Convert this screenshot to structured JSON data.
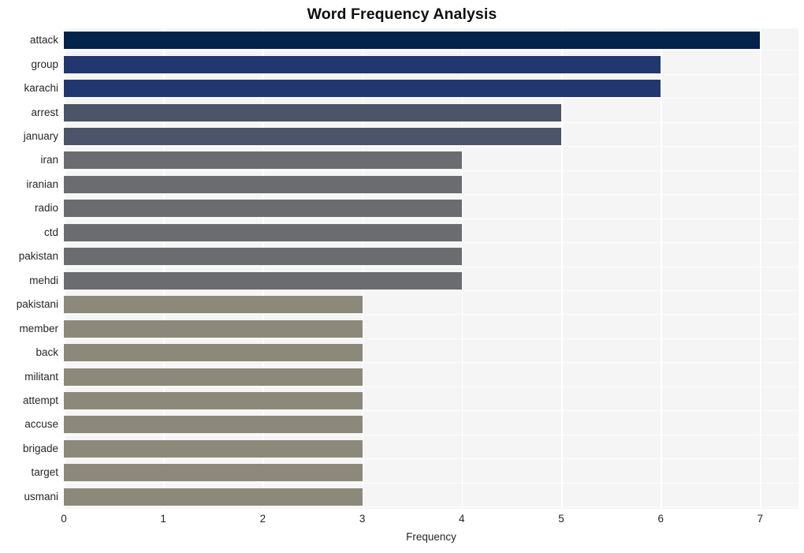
{
  "chart_data": {
    "type": "bar",
    "orientation": "horizontal",
    "title": "Word Frequency Analysis",
    "xlabel": "Frequency",
    "ylabel": "",
    "xlim": [
      0,
      7.385
    ],
    "xticks": [
      0,
      1,
      2,
      3,
      4,
      5,
      6,
      7
    ],
    "xticklabels": [
      "0",
      "1",
      "2",
      "3",
      "4",
      "5",
      "6",
      "7"
    ],
    "grid": true,
    "legend": false,
    "categories": [
      "attack",
      "group",
      "karachi",
      "arrest",
      "january",
      "iran",
      "iranian",
      "radio",
      "ctd",
      "pakistan",
      "mehdi",
      "pakistani",
      "member",
      "back",
      "militant",
      "attempt",
      "accuse",
      "brigade",
      "target",
      "usmani"
    ],
    "values": [
      7,
      6,
      6,
      5,
      5,
      4,
      4,
      4,
      4,
      4,
      4,
      3,
      3,
      3,
      3,
      3,
      3,
      3,
      3,
      3
    ],
    "bar_colors": [
      "#03234b",
      "#22376f",
      "#24386f",
      "#4b5468",
      "#4d soluzione",
      "#6b6c70",
      "#6b6c70",
      "#6b6c70",
      "#6b6c70",
      "#6b6c70",
      "#6b6c70",
      "#8d897a",
      "#8d897a",
      "#8d897a",
      "#8d897a",
      "#8d897a",
      "#8d897a",
      "#8d897a",
      "#8d897a",
      "#8d897a"
    ],
    "plot_background": "#f5f5f6",
    "grid_color": "#ffffff",
    "text_color": "#26262b"
  },
  "colors": {
    "navy": "#03234b",
    "blue": "#22376f",
    "blue2": "#24386f",
    "slate": "#4b5468",
    "slate2": "#4e5569",
    "gray": "#6b6c70",
    "khaki": "#8d897a",
    "background": "#ffffff",
    "plot_background": "#f5f5f6",
    "grid": "#ffffff",
    "text": "#26262b",
    "title": "#0f0f14"
  }
}
